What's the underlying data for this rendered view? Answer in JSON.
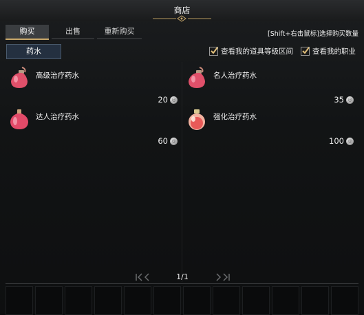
{
  "window": {
    "title": "商店"
  },
  "tabs": [
    {
      "label": "购买",
      "active": true
    },
    {
      "label": "出售",
      "active": false
    },
    {
      "label": "重新购买",
      "active": false
    }
  ],
  "hint": "[Shift+右击鼠标]选择购买数量",
  "category": {
    "label": "药水"
  },
  "filters": [
    {
      "label": "查看我的道具等级区间",
      "checked": true
    },
    {
      "label": "查看我的职业",
      "checked": true
    }
  ],
  "items": [
    {
      "name": "高级治疗药水",
      "price": "20",
      "icon": "red-potion-icon"
    },
    {
      "name": "名人治疗药水",
      "price": "35",
      "icon": "red-potion-icon"
    },
    {
      "name": "达人治疗药水",
      "price": "60",
      "icon": "red-potion-icon"
    },
    {
      "name": "强化治疗药水",
      "price": "100",
      "icon": "round-potion-icon"
    }
  ],
  "pagination": {
    "text": "1/1"
  },
  "colors": {
    "accent": "#c9a96b",
    "category_bg": "#243040"
  }
}
